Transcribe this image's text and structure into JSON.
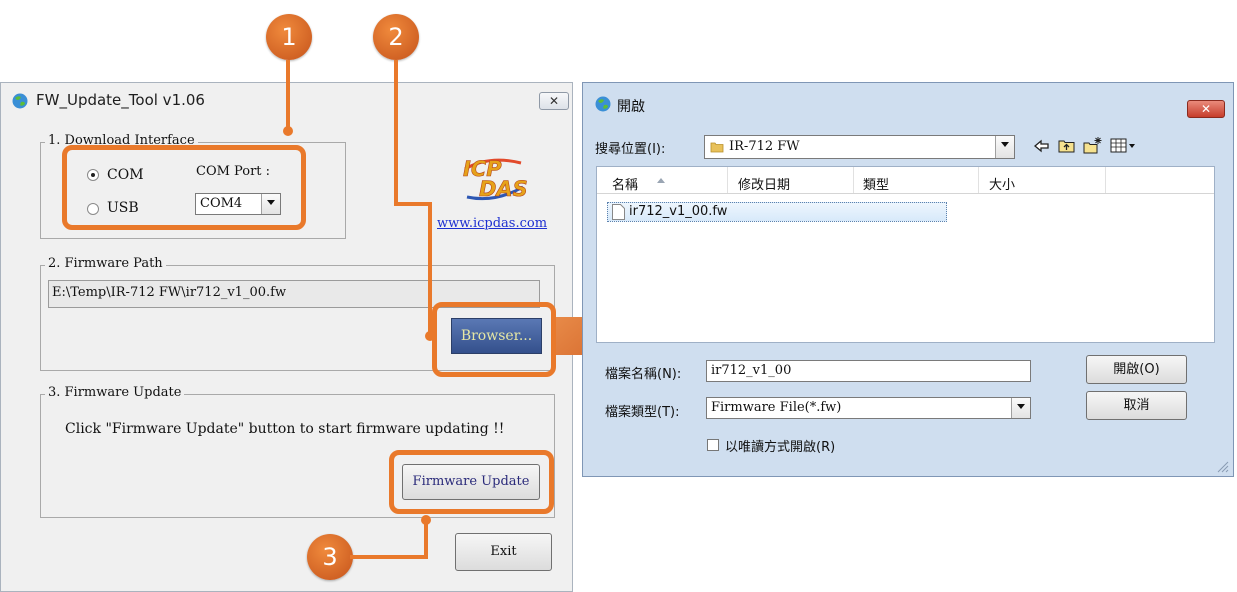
{
  "tool": {
    "title": "FW_Update_Tool v1.06",
    "close_label": "✕",
    "download_interface": {
      "legend": "1. Download Interface",
      "com_label": "COM",
      "usb_label": "USB",
      "com_port_label": "COM Port :",
      "com_port_value": "COM4"
    },
    "logo_text_top": "ICP",
    "logo_text_bottom": "DAS",
    "website": "www.icpdas.com",
    "firmware_path": {
      "legend": "2. Firmware Path",
      "value": "E:\\Temp\\IR-712 FW\\ir712_v1_00.fw",
      "browse_label": "Browser..."
    },
    "firmware_update": {
      "legend": "3. Firmware Update",
      "instruction": "Click  \"Firmware Update\" button to start firmware updating !!",
      "button_label": "Firmware Update"
    },
    "exit_label": "Exit"
  },
  "markers": [
    "1",
    "2",
    "3"
  ],
  "open_dialog": {
    "title": "開啟",
    "close_label": "✕",
    "look_in_label": "搜尋位置(I):",
    "look_in_value": "IR-712 FW",
    "columns": [
      "名稱",
      "修改日期",
      "類型",
      "大小"
    ],
    "files": [
      "ir712_v1_00.fw"
    ],
    "filename_label": "檔案名稱(N):",
    "filename_value": "ir712_v1_00",
    "filetype_label": "檔案類型(T):",
    "filetype_value": "Firmware File(*.fw)",
    "open_button": "開啟(O)",
    "cancel_button": "取消",
    "readonly_label": "以唯讀方式開啟(R)"
  },
  "colors": {
    "accent_orange": "#e9792b",
    "dialog_bg": "#cfdeef",
    "close_red": "#c9483a",
    "browse_blue": "#3f5f9c"
  }
}
